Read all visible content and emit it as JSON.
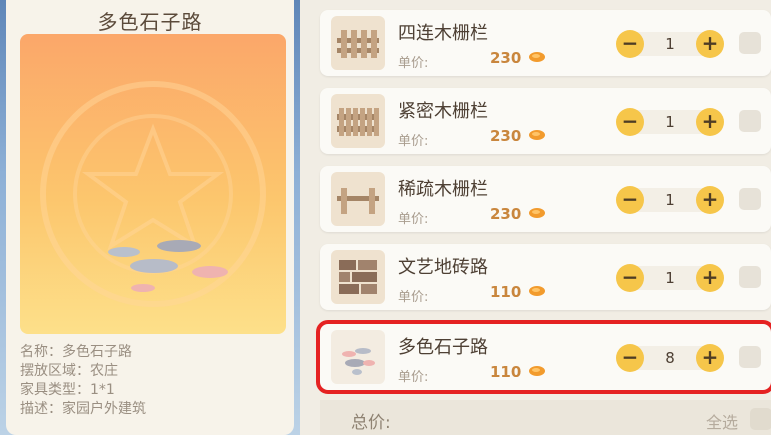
{
  "detail": {
    "title": "多色石子路",
    "info": [
      {
        "label": "名称：",
        "value": "多色石子路"
      },
      {
        "label": "摆放区域：",
        "value": "农庄"
      },
      {
        "label": "家具类型：",
        "value": "1*1"
      },
      {
        "label": "描述：",
        "value": "家园户外建筑"
      }
    ]
  },
  "items": [
    {
      "name": "四连木栅栏",
      "price_label": "单价:",
      "price": "230",
      "qty": "1",
      "icon": "four-fence-icon"
    },
    {
      "name": "紧密木栅栏",
      "price_label": "单价:",
      "price": "230",
      "qty": "1",
      "icon": "dense-fence-icon"
    },
    {
      "name": "稀疏木栅栏",
      "price_label": "单价:",
      "price": "230",
      "qty": "1",
      "icon": "sparse-fence-icon"
    },
    {
      "name": "文艺地砖路",
      "price_label": "单价:",
      "price": "110",
      "qty": "1",
      "icon": "brick-path-icon"
    },
    {
      "name": "多色石子路",
      "price_label": "单价:",
      "price": "110",
      "qty": "8",
      "icon": "pebble-path-icon",
      "selected": true
    }
  ],
  "stepper": {
    "minus": "−",
    "plus": "+"
  },
  "footer": {
    "total_label": "总价:",
    "select_all": "全选"
  },
  "colors": {
    "highlight": "#e52222",
    "button": "#f6c64a",
    "price": "#c9863d"
  }
}
